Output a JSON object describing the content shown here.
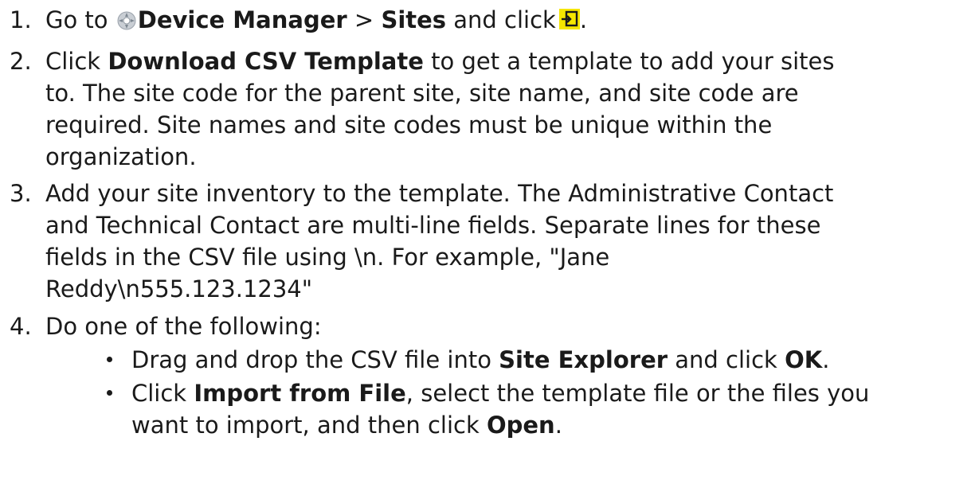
{
  "step1": {
    "number": "1.",
    "prefix": "Go to",
    "device_manager": "Device Manager",
    "sep": ">",
    "sites": "Sites",
    "and_click": "and click",
    "period": "."
  },
  "step2": {
    "number": "2.",
    "click": "Click",
    "download": "Download CSV Template",
    "line1_rest": "to get a template to add your sites",
    "line2": "to. The site code for the parent site, site name, and site code are",
    "line3": "required. Site names and site codes must be unique within the",
    "line4": "organization."
  },
  "step3": {
    "number": "3.",
    "line1": "Add your site inventory to the template. The Administrative Contact",
    "line2": "and Technical Contact are multi-line fields. Separate lines for these",
    "line3": "fields in the CSV file using \\n. For example, \"Jane",
    "line4": "Reddy\\n555.123.1234\""
  },
  "step4": {
    "number": "4.",
    "intro": "Do one of the following:",
    "bullet1": {
      "prefix": "Drag and drop the CSV file into",
      "site_explorer": "Site Explorer",
      "middle": "and click",
      "ok": "OK",
      "end": "."
    },
    "bullet2": {
      "click": "Click",
      "import": "Import from File",
      "rest": ", select the template file or the files you",
      "line2_prefix": "want to import, and then click",
      "open": "Open",
      "end": "."
    }
  },
  "icons": {
    "device_manager": "device-manager-icon",
    "import_site": "import-icon",
    "import_icon_bg": "#f5e600",
    "import_icon_fg": "#1a1a1a"
  }
}
